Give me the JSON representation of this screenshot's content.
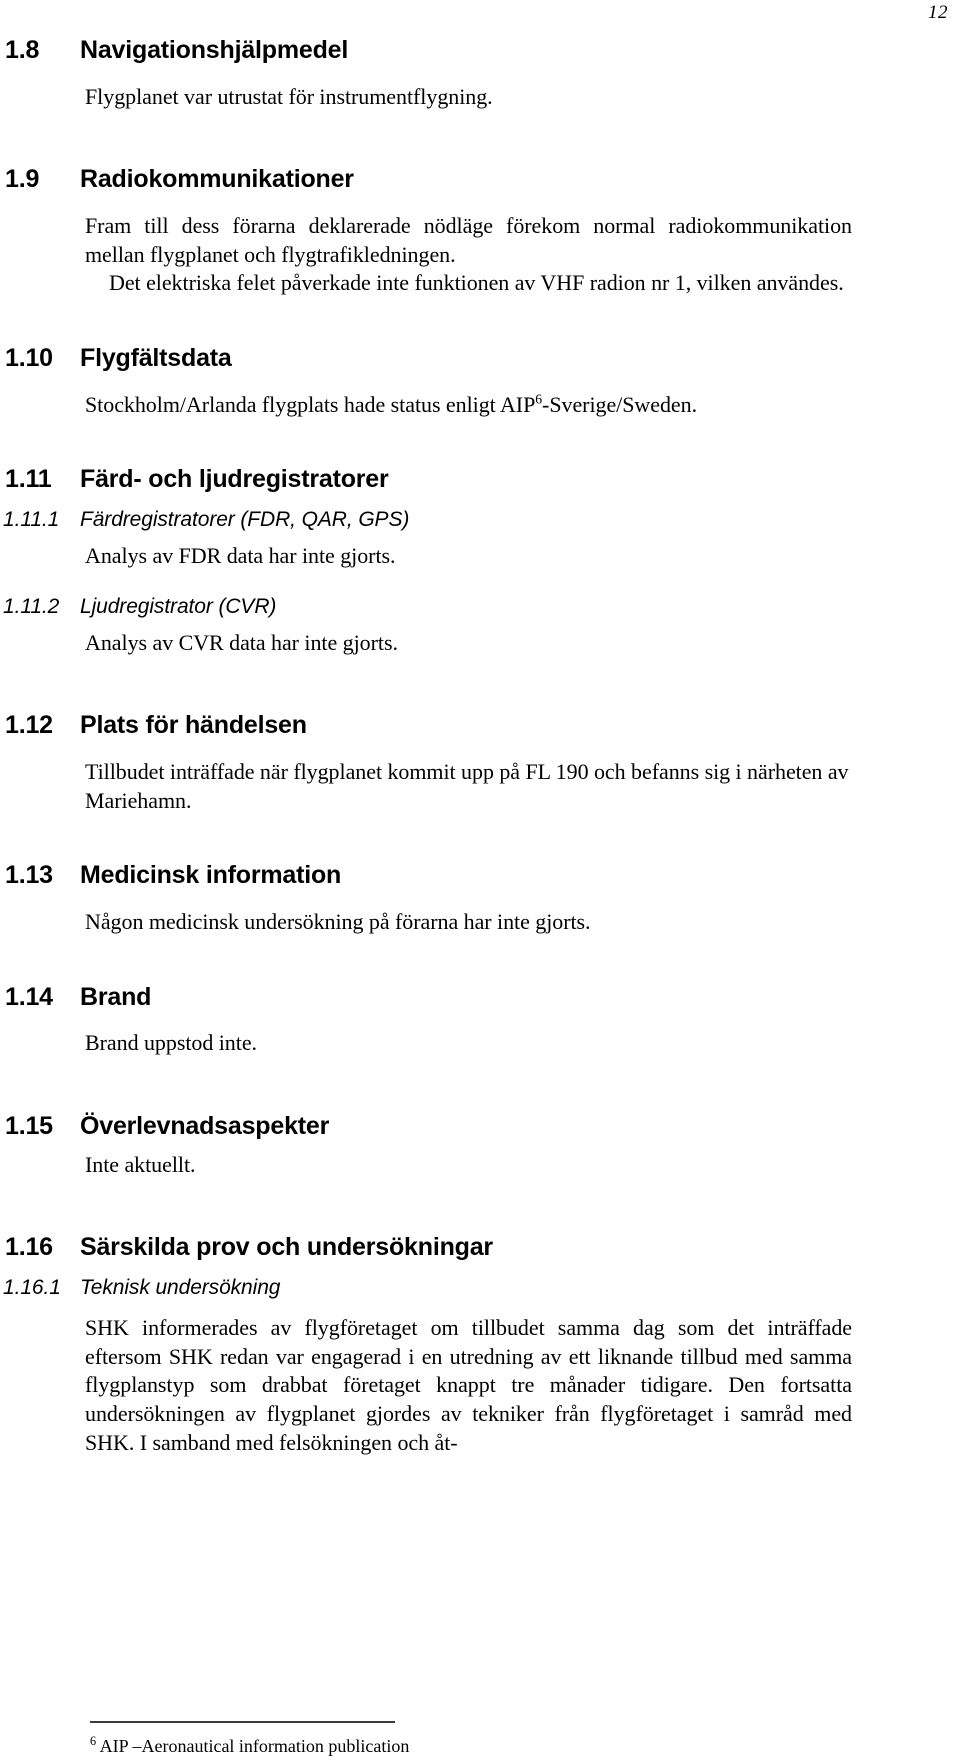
{
  "page": {
    "number": "12"
  },
  "sections": [
    {
      "id": "1.8",
      "number": "1.8",
      "title": "Navigationshjälpmedel",
      "body": "Flygplanet var utrustat för instrumentflygning."
    },
    {
      "id": "1.9",
      "number": "1.9",
      "title": "Radiokommunikationer",
      "body_p1": "Fram till dess förarna deklarerade nödläge förekom normal radiokommunikation mellan flygplanet och flygtrafikledningen.",
      "body_p2": "Det elektriska felet påverkade inte funktionen av VHF radion nr 1, vilken användes."
    },
    {
      "id": "1.10",
      "number": "1.10",
      "title": "Flygfältsdata",
      "body_before": "Stockholm/Arlanda flygplats hade status enligt AIP",
      "body_superscript": "6",
      "body_after": "-Sverige/Sweden."
    },
    {
      "id": "1.11",
      "number": "1.11",
      "title": "Färd- och ljudregistratorer",
      "subsections": [
        {
          "number": "1.11.1",
          "title": "Färdregistratorer (FDR, QAR, GPS)",
          "body": "Analys av FDR data har inte gjorts."
        },
        {
          "number": "1.11.2",
          "title": "Ljudregistrator (CVR)",
          "body": "Analys av CVR data har inte gjorts."
        }
      ]
    },
    {
      "id": "1.12",
      "number": "1.12",
      "title": "Plats för händelsen",
      "body": "Tillbudet inträffade när flygplanet kommit upp på FL 190 och befanns sig i närheten av Mariehamn."
    },
    {
      "id": "1.13",
      "number": "1.13",
      "title": "Medicinsk information",
      "body": "Någon medicinsk undersökning på förarna har inte gjorts."
    },
    {
      "id": "1.14",
      "number": "1.14",
      "title": "Brand",
      "body": "Brand uppstod inte."
    },
    {
      "id": "1.15",
      "number": "1.15",
      "title": "Överlevnadsaspekter",
      "body": "Inte aktuellt."
    },
    {
      "id": "1.16",
      "number": "1.16",
      "title": "Särskilda prov och undersökningar",
      "subsections": [
        {
          "number": "1.16.1",
          "title": "Teknisk undersökning",
          "body": "SHK informerades av flygföretaget om tillbudet samma dag som det inträffade eftersom SHK redan var engagerad i en utredning av ett liknande tillbud med samma flygplanstyp som drabbat företaget knappt tre månader tidigare. Den fortsatta undersökningen av flygplanet gjordes av tekniker från flygföretaget i samråd med SHK. I samband med felsökningen och åt-"
        }
      ]
    }
  ],
  "footnote": {
    "marker": "6",
    "text": "AIP –Aeronautical information publication"
  }
}
